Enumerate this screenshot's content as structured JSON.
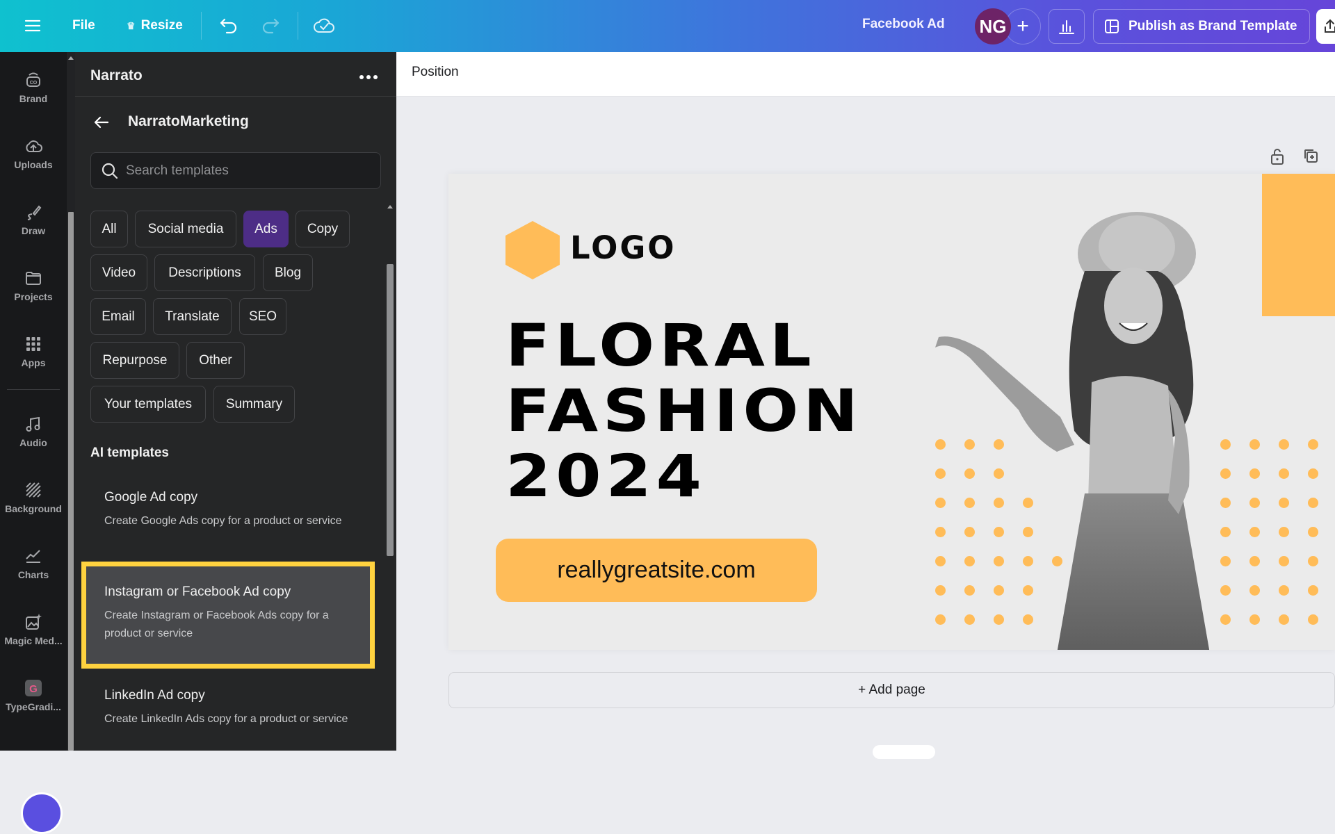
{
  "topbar": {
    "menu_icon": "hamburger-menu-icon",
    "file_label": "File",
    "resize_label": "Resize",
    "resize_icon": "crown-icon",
    "undo_icon": "undo-icon",
    "redo_icon": "redo-icon",
    "save_status_icon": "cloud-check-icon",
    "doc_title": "Facebook Ad",
    "avatar_initials": "NG",
    "add_collaborator_icon": "plus-icon",
    "insights_icon": "bar-chart-icon",
    "publish_label": "Publish as Brand Template",
    "publish_icon": "brand-template-icon",
    "share_icon": "share-icon"
  },
  "rail": {
    "items": [
      {
        "label": "Brand",
        "icon": "brand-icon"
      },
      {
        "label": "Uploads",
        "icon": "cloud-upload-icon"
      },
      {
        "label": "Draw",
        "icon": "draw-pen-icon"
      },
      {
        "label": "Projects",
        "icon": "folder-icon"
      },
      {
        "label": "Apps",
        "icon": "apps-grid-icon"
      },
      {
        "label": "Audio",
        "icon": "music-note-icon"
      },
      {
        "label": "Background",
        "icon": "background-hatch-icon"
      },
      {
        "label": "Charts",
        "icon": "line-chart-icon"
      },
      {
        "label": "Magic Med...",
        "icon": "magic-media-icon"
      },
      {
        "label": "TypeGradi...",
        "icon": "typegradient-app-icon"
      }
    ]
  },
  "panel": {
    "title": "Narrato",
    "more_icon": "more-horizontal-icon",
    "back_icon": "arrow-left-icon",
    "subtitle": "NarratoMarketing",
    "search": {
      "placeholder": "Search templates",
      "value": ""
    },
    "chips": [
      {
        "label": "All",
        "active": false
      },
      {
        "label": "Social media",
        "active": false
      },
      {
        "label": "Ads",
        "active": true
      },
      {
        "label": "Copy",
        "active": false
      },
      {
        "label": "Video",
        "active": false
      },
      {
        "label": "Descriptions",
        "active": false
      },
      {
        "label": "Blog",
        "active": false
      },
      {
        "label": "Email",
        "active": false
      },
      {
        "label": "Translate",
        "active": false
      },
      {
        "label": "SEO",
        "active": false
      },
      {
        "label": "Repurpose",
        "active": false
      },
      {
        "label": "Other",
        "active": false
      },
      {
        "label": "Your templates",
        "active": false
      },
      {
        "label": "Summary",
        "active": false
      }
    ],
    "section_title": "AI templates",
    "templates": [
      {
        "name": "Google Ad copy",
        "desc": "Create Google Ads copy for a product or service",
        "highlighted": false
      },
      {
        "name": "Instagram or Facebook Ad copy",
        "desc": "Create Instagram or Facebook Ads copy for a product or service",
        "highlighted": true
      },
      {
        "name": "LinkedIn Ad copy",
        "desc": "Create LinkedIn Ads copy for a product or service",
        "highlighted": false
      }
    ]
  },
  "context_bar": {
    "position_label": "Position"
  },
  "page_controls": {
    "lock_icon": "unlock-icon",
    "duplicate_icon": "duplicate-page-icon"
  },
  "design": {
    "logo_text": "LOGO",
    "headline_lines": [
      "FLORAL",
      "FASHION",
      "2024"
    ],
    "url": "reallygreatsite.com",
    "accent_color": "#ffbc58"
  },
  "add_page_label": "+ Add page",
  "colors": {
    "chip_active": "#4d2d86",
    "highlight_outline": "#ffd23f",
    "avatar_bg": "#6d2367"
  }
}
